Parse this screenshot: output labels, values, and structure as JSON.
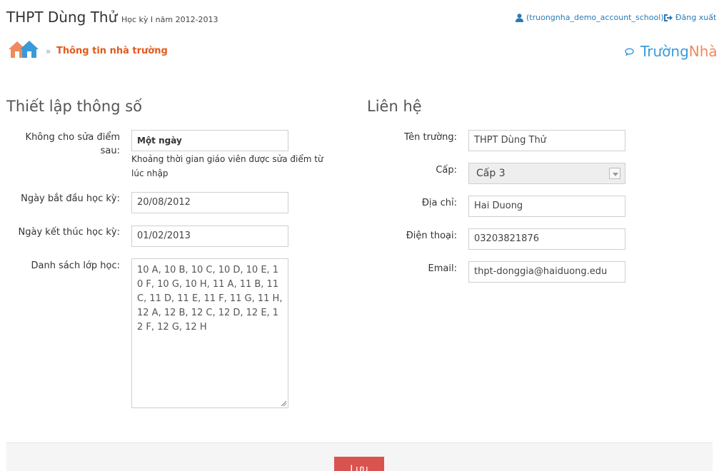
{
  "header": {
    "school_name": "THPT Dùng Thử",
    "term": "Học kỳ I năm 2012-2013",
    "user": "(truongnha_demo_account_school)",
    "logout": "Đăng xuất"
  },
  "breadcrumb": {
    "separator": "»",
    "current": "Thông tin nhà trường"
  },
  "brand": {
    "part1": "Trường",
    "part2": "Nhà"
  },
  "settings": {
    "title": "Thiết lập thông số",
    "lock_label": "Không cho sửa điểm sau:",
    "lock_value": "Một ngày",
    "lock_help": "Khoảng thời gian giáo viên được sửa điểm từ lúc nhập",
    "start_label": "Ngày bắt đầu học kỳ:",
    "start_value": "20/08/2012",
    "end_label": "Ngày kết thúc học kỳ:",
    "end_value": "01/02/2013",
    "classes_label": "Danh sách lớp học:",
    "classes_value": "10 A, 10 B, 10 C, 10 D, 10 E, 10 F, 10 G, 10 H, 11 A, 11 B, 11 C, 11 D, 11 E, 11 F, 11 G, 11 H, 12 A, 12 B, 12 C, 12 D, 12 E, 12 F, 12 G, 12 H"
  },
  "contact": {
    "title": "Liên hệ",
    "name_label": "Tên trường:",
    "name_value": "THPT Dùng Thử",
    "level_label": "Cấp:",
    "level_value": "Cấp 3",
    "address_label": "Địa chỉ:",
    "address_value": "Hai Duong",
    "phone_label": "Điện thoại:",
    "phone_value": "03203821876",
    "email_label": "Email:",
    "email_value": "thpt-donggia@haiduong.edu"
  },
  "actions": {
    "save": "Lưu"
  },
  "icons": {
    "user": "user-icon",
    "logout": "logout-icon",
    "home": "home-icon",
    "brand": "chat-bubble-icon"
  },
  "colors": {
    "link": "#2a7ab5",
    "breadcrumb_active": "#e25a1c",
    "brand_blue": "#3a9ad9",
    "brand_orange": "#f08a5d",
    "save_button": "#d9534f"
  }
}
